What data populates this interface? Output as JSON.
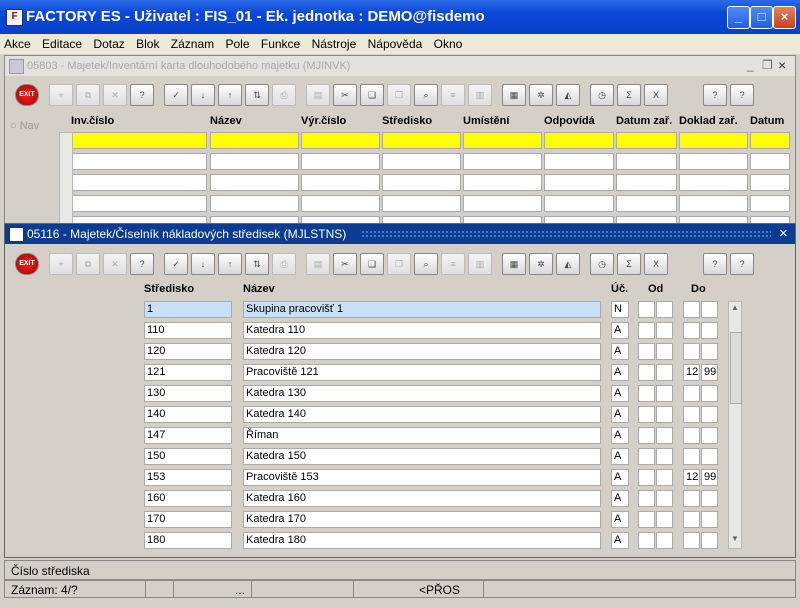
{
  "app": {
    "title": "FACTORY ES - Uživatel : FIS_01 - Ek. jednotka : DEMO@fisdemo"
  },
  "menu": [
    "Akce",
    "Editace",
    "Dotaz",
    "Blok",
    "Záznam",
    "Pole",
    "Funkce",
    "Nástroje",
    "Nápověda",
    "Okno"
  ],
  "bg_window": {
    "title": "05803 - Majetek/Inventární karta dlouhodobého majetku (MJINVK)",
    "nav_label": "Nav",
    "columns": [
      "Inv.číslo",
      "Název",
      "Výr.číslo",
      "Středisko",
      "Umístění",
      "Odpovídá",
      "Datum zař.",
      "Doklad zař.",
      "Datum"
    ]
  },
  "fg_window": {
    "title": "05116 - Majetek/Číselník nákladových středisek (MJLSTNS)",
    "close": "×",
    "columns": {
      "stredisko": "Středisko",
      "nazev": "Název",
      "uct": "Úč.",
      "od": "Od",
      "do": "Do"
    },
    "rows": [
      {
        "stredisko": "1",
        "nazev": "Skupina pracovišť 1",
        "uct": "N",
        "do1": "",
        "do2": ""
      },
      {
        "stredisko": "110",
        "nazev": "Katedra 110",
        "uct": "A",
        "do1": "",
        "do2": ""
      },
      {
        "stredisko": "120",
        "nazev": "Katedra 120",
        "uct": "A",
        "do1": "",
        "do2": ""
      },
      {
        "stredisko": "121",
        "nazev": "Pracoviště 121",
        "uct": "A",
        "do1": "12",
        "do2": "99"
      },
      {
        "stredisko": "130",
        "nazev": "Katedra 130",
        "uct": "A",
        "do1": "",
        "do2": ""
      },
      {
        "stredisko": "140",
        "nazev": "Katedra 140",
        "uct": "A",
        "do1": "",
        "do2": ""
      },
      {
        "stredisko": "147",
        "nazev": "Říman",
        "uct": "A",
        "do1": "",
        "do2": ""
      },
      {
        "stredisko": "150",
        "nazev": "Katedra 150",
        "uct": "A",
        "do1": "",
        "do2": ""
      },
      {
        "stredisko": "153",
        "nazev": "Pracoviště 153",
        "uct": "A",
        "do1": "12",
        "do2": "99"
      },
      {
        "stredisko": "160",
        "nazev": "Katedra 160",
        "uct": "A",
        "do1": "",
        "do2": ""
      },
      {
        "stredisko": "170",
        "nazev": "Katedra 170",
        "uct": "A",
        "do1": "",
        "do2": ""
      },
      {
        "stredisko": "180",
        "nazev": "Katedra 180",
        "uct": "A",
        "do1": "",
        "do2": ""
      }
    ]
  },
  "toolbar": {
    "exit_label": "EXIT",
    "icons": [
      "exit-icon",
      "insert-record-icon",
      "duplicate-record-icon",
      "delete-record-icon",
      "query-enter-icon",
      "query-execute-icon",
      "sort-asc-icon",
      "sort-desc-icon",
      "sort-multi-icon",
      "print-icon",
      "print-preview-icon",
      "cut-icon",
      "copy-icon",
      "paste-icon",
      "find-icon",
      "list-icon",
      "columns-icon",
      "calculator-icon",
      "settings-icon",
      "ruler-icon",
      "clock-icon",
      "sum-icon",
      "excel-icon",
      "help-icon",
      "context-help-icon"
    ]
  },
  "status": {
    "hint": "Číslo střediska",
    "record": "Záznam: 4/?",
    "ellipsis": "...",
    "mode": "<PŘOS"
  },
  "colors": {
    "titlebar": "#0a46d8",
    "highlight": "#ffff00",
    "selected_cell": "#c8e0f8",
    "fg_title": "#0a3c94"
  }
}
